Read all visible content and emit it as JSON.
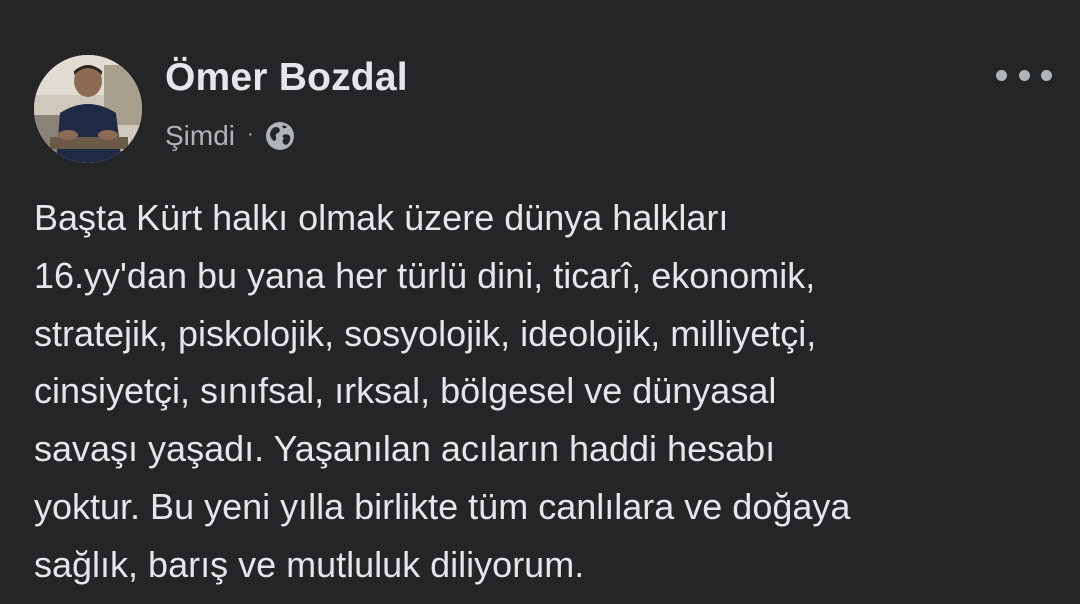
{
  "post": {
    "author": "Ömer Bozdal",
    "time": "Şimdi",
    "separator": "·",
    "audience_icon": "globe-icon",
    "more_icon": "more-options-icon",
    "text_lines": [
      "Başta Kürt halkı olmak üzere dünya halkları",
      "16.yy'dan bu yana her türlü dini, ticarî, ekonomik,",
      "stratejik, piskolojik, sosyolojik, ideolojik, milliyetçi,",
      "cinsiyetçi, sınıfsal, ırksal, bölgesel ve dünyasal",
      "savaşı yaşadı. Yaşanılan acıların haddi hesabı",
      "yoktur. Bu yeni yılla birlikte tüm canlılara ve doğaya",
      "sağlık, barış ve mutluluk diliyorum."
    ]
  },
  "colors": {
    "background": "#242526",
    "primary_text": "#e4e6eb",
    "secondary_text": "#b0b3b8"
  }
}
